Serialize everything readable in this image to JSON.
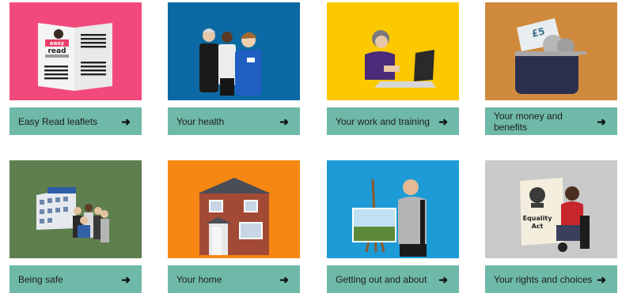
{
  "colors": {
    "bar": "#6fb9a8",
    "pink": "#f2497c",
    "blue": "#0b6aa3",
    "yellow": "#fcc800",
    "ochre": "#d08a3e",
    "green": "#5f7f4f",
    "orange": "#f68712",
    "skyblue": "#1d9bd6",
    "grey": "#c9c9c9"
  },
  "cards": [
    {
      "label": "Easy Read leaflets",
      "icon": "arrow-right-icon",
      "logo_text": "easy read"
    },
    {
      "label": "Your health",
      "icon": "arrow-right-icon"
    },
    {
      "label": "Your work and training",
      "icon": "arrow-right-icon"
    },
    {
      "label": "Your money and benefits",
      "icon": "arrow-right-icon",
      "note_text": "£5"
    },
    {
      "label": "Being safe",
      "icon": "arrow-right-icon"
    },
    {
      "label": "Your home",
      "icon": "arrow-right-icon"
    },
    {
      "label": "Getting out and about",
      "icon": "arrow-right-icon"
    },
    {
      "label": "Your rights and choices",
      "icon": "arrow-right-icon",
      "document_text": "Equality Act"
    }
  ],
  "arrow_glyph": "➜"
}
